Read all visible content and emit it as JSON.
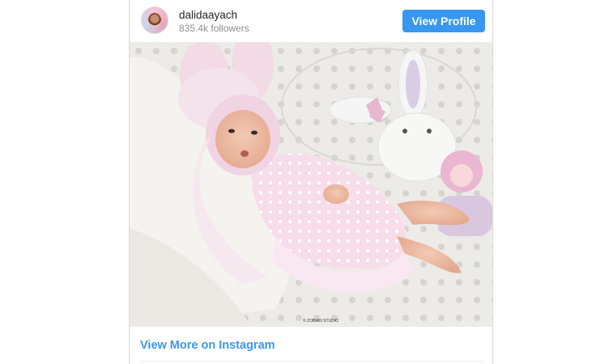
{
  "post": {
    "username": "dalidaayach",
    "followers": "835.4k followers",
    "view_profile_label": "View Profile",
    "photo_credit": "© ZOBIAN STUDIO",
    "view_more_label": "View More on Instagram"
  },
  "colors": {
    "accent": "#3897f0",
    "text_primary": "#262626",
    "text_secondary": "#8e8e8e",
    "border": "#dbdbdb"
  },
  "icons": {
    "avatar": "profile-picture"
  }
}
